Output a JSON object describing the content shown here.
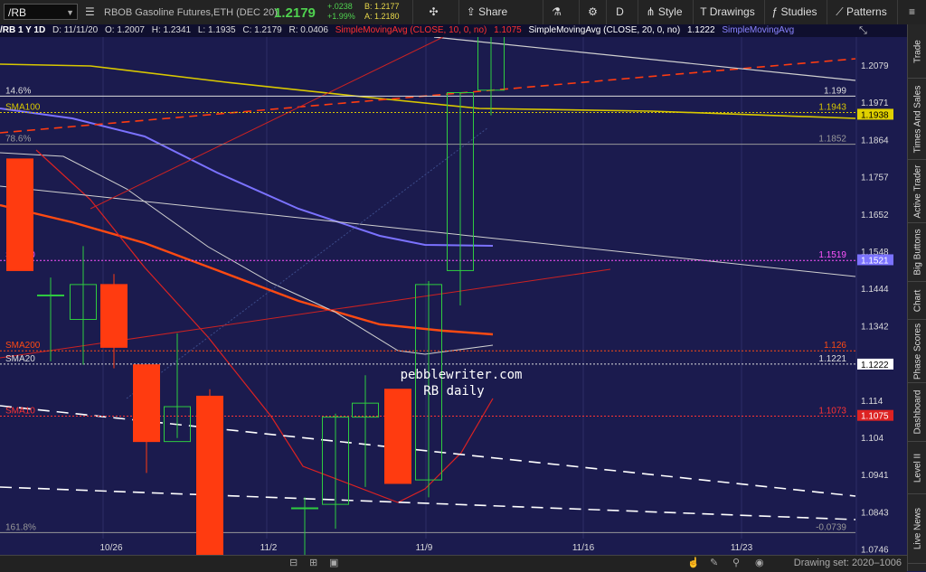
{
  "toolbar": {
    "symbol": "/RB",
    "description": "RBOB Gasoline Futures,ETH (DEC 20)",
    "last": "1.2179",
    "change": "+.0238",
    "change_pct": "+1.99%",
    "bid": "B: 1.2177",
    "ask": "A: 1.2180",
    "share": "Share",
    "period": "D",
    "style": "Style",
    "drawings": "Drawings",
    "studies": "Studies",
    "patterns": "Patterns"
  },
  "infobar": {
    "symbol": "/RB 1 Y 1D",
    "date": "D: 11/11/20",
    "open": "O: 1.2007",
    "high": "H: 1.2341",
    "low": "L: 1.1935",
    "close": "C: 1.2179",
    "range": "R: 0.0406",
    "sma10": "SimpleMovingAvg (CLOSE, 10, 0, no)",
    "sma10_val": "1.1075",
    "sma20": "SimpleMovingAvg (CLOSE, 20, 0, no)",
    "sma20_val": "1.1222",
    "sma50_cut": "SimpleMovingAvg"
  },
  "sidebar": [
    "Trade",
    "Times And Sales",
    "Active Trader",
    "Big Buttons",
    "Chart",
    "Phase Scores",
    "Dashboard",
    "Level II",
    "Live News"
  ],
  "bottombar": {
    "drawing_set": "Drawing set: 2020–1006"
  },
  "watermark": [
    "pebblewriter.com",
    "RB daily"
  ],
  "colors": {
    "background": "#1b1b4e",
    "up": "#2ecc40",
    "down": "#ff3b10",
    "sma10": "#dd2222",
    "sma20": "#d0d0d0",
    "sma50": "#7b72ff",
    "sma100": "#d9c800",
    "sma200": "#ff4a12"
  },
  "chart_data": {
    "type": "candlestick",
    "y_axis": {
      "position": "right",
      "ticks": [
        "1.2079",
        "1.1971",
        "1.1864",
        "1.1757",
        "1.1652",
        "1.1548",
        "1.1444",
        "1.1342",
        "1.124",
        "1.114",
        "1.104",
        "1.0941",
        "1.0843",
        "1.0746"
      ]
    },
    "x_axis": {
      "ticks": [
        "10/26",
        "11/2",
        "11/9",
        "11/16",
        "11/23"
      ]
    },
    "candles": [
      {
        "o": 1.181,
        "h": 1.181,
        "l": 1.149,
        "c": 1.149
      },
      {
        "o": 1.142,
        "h": 1.147,
        "l": 1.123,
        "c": 1.142
      },
      {
        "o": 1.135,
        "h": 1.156,
        "l": 1.122,
        "c": 1.145
      },
      {
        "o": 1.145,
        "h": 1.148,
        "l": 1.121,
        "c": 1.127
      },
      {
        "o": 1.122,
        "h": 1.122,
        "l": 1.091,
        "c": 1.1
      },
      {
        "o": 1.1,
        "h": 1.131,
        "l": 1.101,
        "c": 1.11
      },
      {
        "o": 1.113,
        "h": 1.115,
        "l": 1.058,
        "c": 1.06
      },
      {
        "o": 1.081,
        "h": 1.084,
        "l": 1.06,
        "c": 1.081
      },
      {
        "o": 1.082,
        "h": 1.108,
        "l": 1.075,
        "c": 1.107
      },
      {
        "o": 1.107,
        "h": 1.119,
        "l": 1.087,
        "c": 1.111
      },
      {
        "o": 1.115,
        "h": 1.115,
        "l": 1.088,
        "c": 1.088
      },
      {
        "o": 1.089,
        "h": 1.146,
        "l": 1.084,
        "c": 1.145
      },
      {
        "o": 1.149,
        "h": 1.2,
        "l": 1.139,
        "c": 1.2
      },
      {
        "o": 1.2007,
        "h": 1.2341,
        "l": 1.1935,
        "c": 1.2179
      }
    ],
    "levels": [
      {
        "name": "14.6%",
        "value": 1.199,
        "label": "1.199"
      },
      {
        "name": "SMA100",
        "value": 1.1943,
        "label": "1.1943"
      },
      {
        "name": "78.6%",
        "value": 1.1852,
        "label": "1.1852"
      },
      {
        "name": "SMA50",
        "value": 1.1519,
        "label": "1.1519"
      },
      {
        "name": "SMA200",
        "value": 1.126,
        "label": "1.126"
      },
      {
        "name": "SMA20",
        "value": 1.1222,
        "label": "1.1221"
      },
      {
        "name": "SMA10",
        "value": 1.1073,
        "label": "1.1073"
      },
      {
        "name": "161.8%",
        "value": 1.0739,
        "label": "-0.0739"
      }
    ],
    "price_tags": [
      {
        "value": 1.1938,
        "label": "1.1938"
      },
      {
        "value": 1.1521,
        "label": "1.1521"
      },
      {
        "value": 1.1222,
        "label": "1.1222"
      },
      {
        "value": 1.1075,
        "label": "1.1075"
      }
    ]
  }
}
